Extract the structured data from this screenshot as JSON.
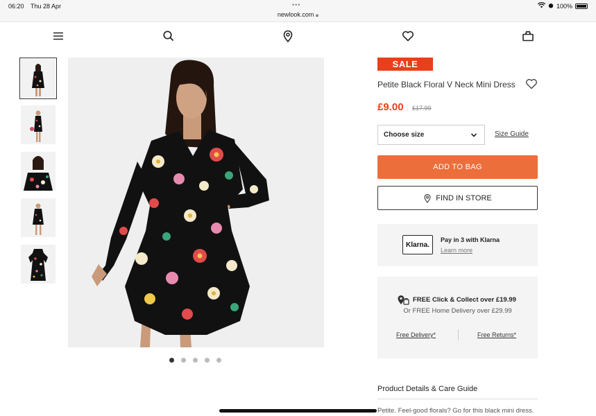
{
  "status_bar": {
    "time": "06:20",
    "date": "Thu 28 Apr",
    "dots": "•••",
    "url": "newlook.com",
    "battery": "100%"
  },
  "nav": {
    "icons": [
      "menu-icon",
      "search-icon",
      "location-pin-icon",
      "heart-icon",
      "bag-icon"
    ]
  },
  "gallery": {
    "thumbnail_count": 5,
    "active_index": 0,
    "dot_count": 5
  },
  "product": {
    "badge": "SALE",
    "title": "Petite Black Floral V Neck Mini Dress",
    "price": "£9.00",
    "old_price": "£17.99",
    "size_placeholder": "Choose size",
    "size_guide": "Size Guide",
    "add_to_bag": "ADD TO BAG",
    "find_in_store": "FIND IN STORE"
  },
  "klarna": {
    "logo": "Klarna.",
    "title": "Pay in 3 with Klarna",
    "link": "Learn more"
  },
  "delivery": {
    "title": "FREE Click & Collect over £19.99",
    "subtitle": "Or FREE Home Delivery over £29.99",
    "link_delivery": "Free Delivery*",
    "link_returns": "Free Returns*"
  },
  "details": {
    "heading": "Product Details & Care Guide",
    "text": "Petite. Feel-good florals? Go for this black mini dress."
  },
  "colors": {
    "accent": "#e8401c",
    "button": "#ec6e3b"
  }
}
